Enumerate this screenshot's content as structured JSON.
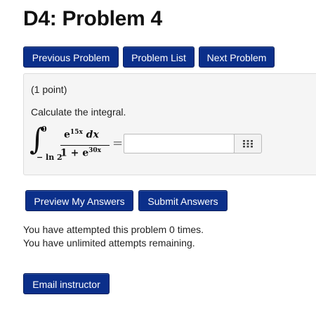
{
  "page": {
    "title": "D4: Problem 4"
  },
  "nav": {
    "previous_label": "Previous Problem",
    "list_label": "Problem List",
    "next_label": "Next Problem"
  },
  "problem": {
    "points": "(1 point)",
    "instructions": "Calculate the integral.",
    "integral": {
      "upper_limit": "0",
      "lower_limit": "− ln 2",
      "numerator": "e",
      "numerator_exp": "15x",
      "numerator_tail": " dx",
      "denominator": "1 + e",
      "denominator_exp": "30x",
      "equals": "="
    },
    "answer_value": "",
    "answer_placeholder": "",
    "keyboard_icon": "keyboard-grid-icon"
  },
  "actions": {
    "preview_label": "Preview My Answers",
    "submit_label": "Submit Answers"
  },
  "status": {
    "attempts": "You have attempted this problem 0 times.",
    "remaining": "You have unlimited attempts remaining."
  },
  "footer": {
    "email_label": "Email instructor"
  },
  "colors": {
    "button_bg": "#0b2f8a",
    "box_bg": "#f5f5f5",
    "box_border": "#dddddd"
  }
}
